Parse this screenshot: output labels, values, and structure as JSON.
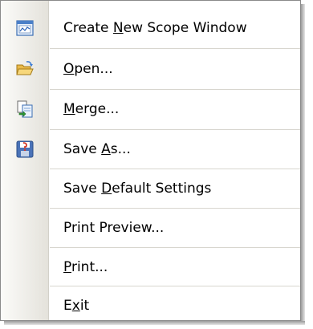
{
  "menu": {
    "items": [
      {
        "pre": "Create ",
        "ul": "N",
        "post": "ew Scope Window",
        "icon": "scope-window-icon"
      },
      {
        "pre": "",
        "ul": "O",
        "post": "pen...",
        "icon": "open-folder-icon"
      },
      {
        "pre": "",
        "ul": "M",
        "post": "erge...",
        "icon": "merge-icon"
      },
      {
        "pre": "Save ",
        "ul": "A",
        "post": "s...",
        "icon": "save-as-icon"
      },
      {
        "pre": "Save ",
        "ul": "D",
        "post": "efault Settings",
        "icon": ""
      },
      {
        "pre": "Print Preview...",
        "ul": "",
        "post": "",
        "icon": ""
      },
      {
        "pre": "",
        "ul": "P",
        "post": "rint...",
        "icon": ""
      },
      {
        "pre": "E",
        "ul": "x",
        "post": "it",
        "icon": ""
      }
    ]
  }
}
